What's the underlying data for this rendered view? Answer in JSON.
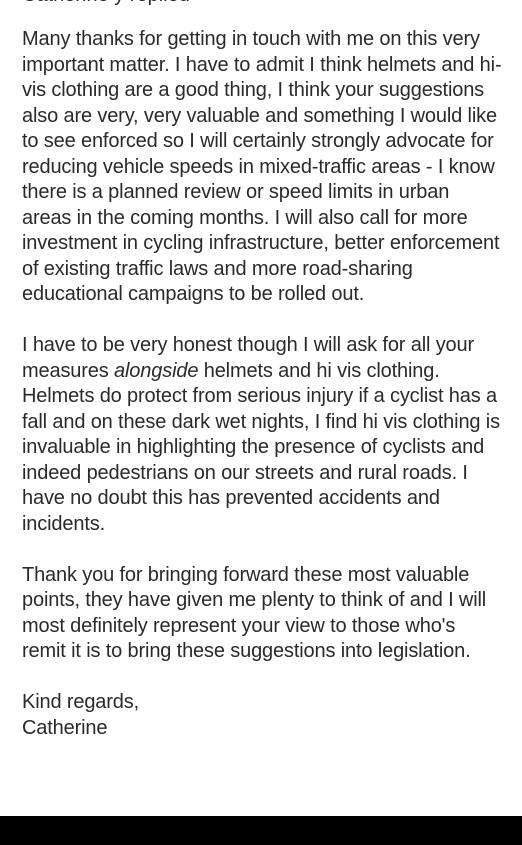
{
  "message": {
    "clipped_top_line": "Catherine y replied",
    "para1": "Many thanks for getting in touch with me on this very important matter. I have to admit I think helmets and hi-vis clothing are a good thing, I think your suggestions also are very, very valuable and something I would like to see enforced so I will certainly strongly advocate for reducing vehicle speeds in mixed-traffic areas - I know there is a planned review or speed limits in urban areas in the coming months. I will also call for more investment in cycling infrastructure, better enforcement of existing traffic laws and more road-sharing educational campaigns to be rolled out.",
    "para2_before": "I have to be very honest though I will ask for all your measures ",
    "para2_italic": "alongside",
    "para2_after": " helmets and hi vis clothing. Helmets do protect from serious injury if a cyclist has a fall and on these dark wet nights, I find hi vis clothing is invaluable in highlighting the presence of cyclists and indeed pedestrians on our streets and rural roads. I have no doubt this has prevented accidents and incidents.",
    "para3": "Thank you for bringing forward these most valuable points, they have given me plenty to think of and I will most definitely represent your view to those who's remit it is to bring these suggestions into legislation.",
    "sign_off": "Kind regards,",
    "signature": "Catherine"
  },
  "colors": {
    "text": "#2a2a2a",
    "background": "#ffffff",
    "bottom_bar": "#000000"
  }
}
